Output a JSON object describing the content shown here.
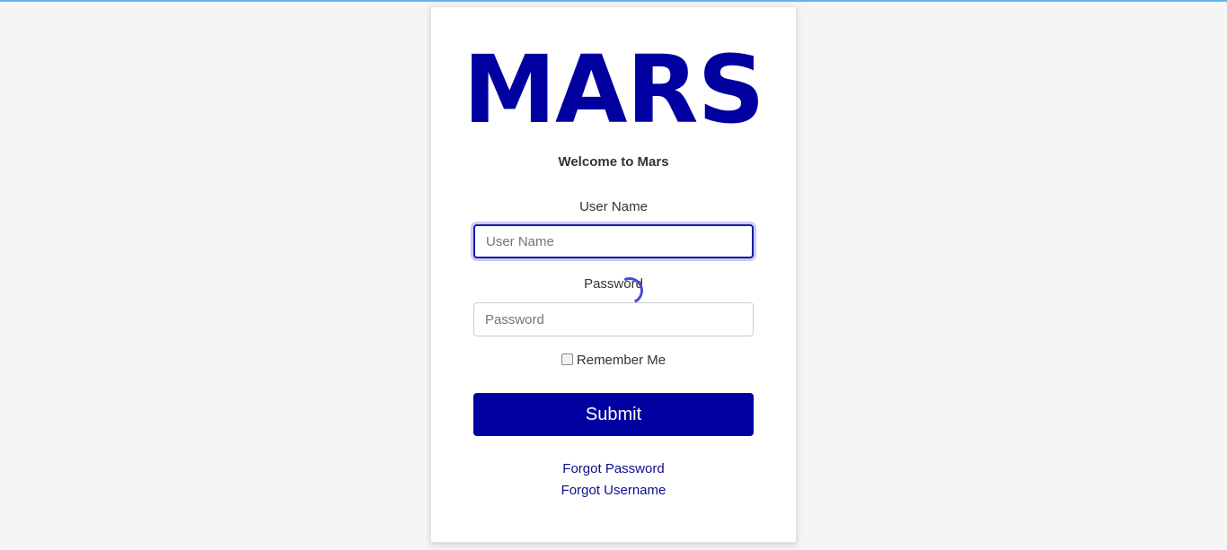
{
  "brand": {
    "logo_text": "MARS",
    "logo_color": "#0000a0"
  },
  "login": {
    "welcome": "Welcome to Mars",
    "username_label": "User Name",
    "username_placeholder": "User Name",
    "username_value": "",
    "password_label": "Password",
    "password_placeholder": "Password",
    "password_value": "",
    "remember_label": "Remember Me",
    "remember_checked": false,
    "submit_label": "Submit",
    "forgot_password": "Forgot Password",
    "forgot_username": "Forgot Username"
  },
  "colors": {
    "accent": "#0000a0",
    "top_bar": "#5cb8ee",
    "background": "#f5f5f5"
  },
  "icons": {
    "loading": "spinner-icon"
  }
}
